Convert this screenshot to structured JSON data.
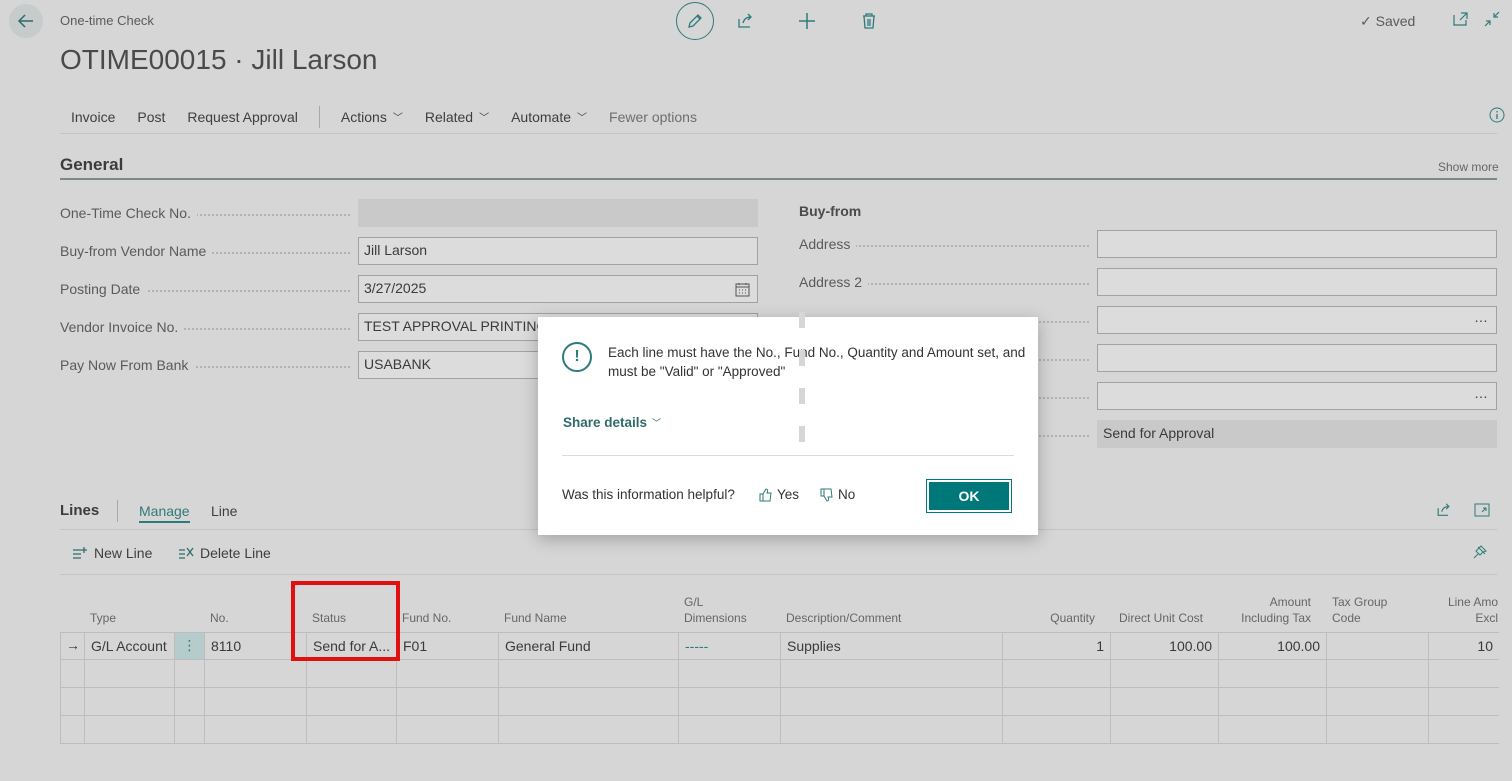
{
  "header": {
    "breadcrumb": "One-time Check",
    "title": "OTIME00015 · Jill Larson",
    "saved_label": "Saved"
  },
  "actionbar": {
    "items": [
      "Invoice",
      "Post",
      "Request Approval"
    ],
    "menus": [
      "Actions",
      "Related",
      "Automate"
    ],
    "fewer": "Fewer options"
  },
  "general": {
    "title": "General",
    "show_more": "Show more",
    "fields": [
      {
        "label": "One-Time Check No.",
        "value": ""
      },
      {
        "label": "Buy-from Vendor Name",
        "value": "Jill Larson"
      },
      {
        "label": "Posting Date",
        "value": "3/27/2025"
      },
      {
        "label": "Vendor Invoice No.",
        "value": "TEST APPROVAL PRINTING"
      },
      {
        "label": "Pay Now From Bank",
        "value": "USABANK"
      }
    ],
    "buy_from_heading": "Buy-from",
    "right_fields": [
      {
        "label": "Address",
        "value": ""
      },
      {
        "label": "Address 2",
        "value": ""
      },
      {
        "label": "",
        "value": ""
      },
      {
        "label": "",
        "value": ""
      },
      {
        "label": "",
        "value": ""
      },
      {
        "label": "",
        "value": "Send for Approval"
      }
    ]
  },
  "lines": {
    "title": "Lines",
    "tabs": [
      "Manage",
      "Line"
    ],
    "new_line": "New Line",
    "delete_line": "Delete Line",
    "columns": {
      "type": "Type",
      "no": "No.",
      "status": "Status",
      "fund_no": "Fund No.",
      "fund_name": "Fund Name",
      "gl_dim_1": "G/L",
      "gl_dim_2": "Dimensions",
      "description": "Description/Comment",
      "quantity": "Quantity",
      "direct_unit_cost": "Direct Unit Cost",
      "amount_incl_1": "Amount",
      "amount_incl_2": "Including Tax",
      "tax_group_1": "Tax Group",
      "tax_group_2": "Code",
      "line_amount_1": "Line Amo",
      "line_amount_2": "Excl"
    },
    "row": {
      "type": "G/L Account",
      "no": "8110",
      "status": "Send for A...",
      "fund_no": "F01",
      "fund_name": "General Fund",
      "gl_dimensions": "-----",
      "description": "Supplies",
      "quantity": "1",
      "direct_unit_cost": "100.00",
      "amount_incl_tax": "100.00",
      "tax_group": "",
      "line_amount": "10"
    }
  },
  "dialog": {
    "message": "Each line must have the No., Fund No., Quantity and Amount set, and must be \"Valid\" or \"Approved\"",
    "share_details": "Share details",
    "helpful_question": "Was this information helpful?",
    "yes": "Yes",
    "no": "No",
    "ok": "OK"
  },
  "colors": {
    "accent": "#00787a",
    "highlight": "#e01010",
    "background": "#d6d6d6"
  }
}
